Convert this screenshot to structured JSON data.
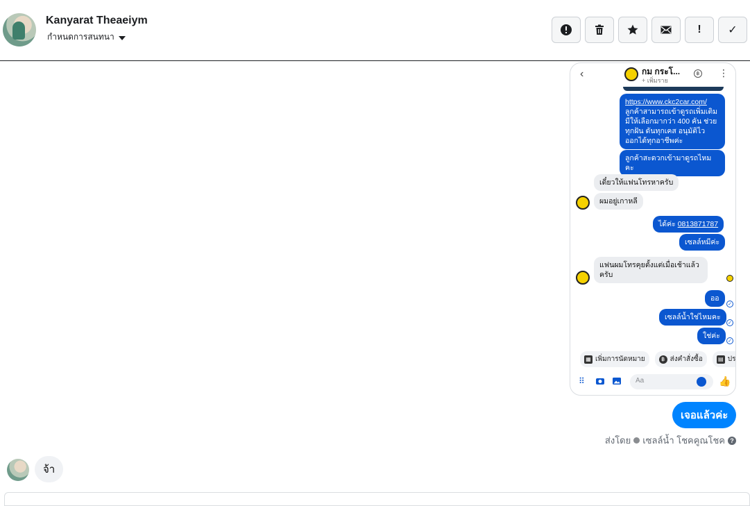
{
  "header": {
    "contact_name": "Kanyarat Theaeiym",
    "assign_label": "กำหนดการสนทนา",
    "actions": [
      {
        "icon": "alert-circle-icon"
      },
      {
        "icon": "trash-icon"
      },
      {
        "icon": "star-icon"
      },
      {
        "icon": "mail-icon"
      },
      {
        "icon": "exclamation-icon",
        "glyph": "!"
      },
      {
        "icon": "check-icon",
        "glyph": "✓"
      }
    ]
  },
  "screenshot": {
    "title": "กม กระโ...",
    "subtitle": "+ เพิ่มราย",
    "messages": {
      "link": "https://www.ckc2car.com/",
      "out1": "ลูกค้าสามารถเข้าดูรถเพิ่มเติม มีให้เลือกมากว่า 400 คัน ช่วยทุกฝัน ดันทุกเคส อนุมัติไว ออกได้ทุกอาชีพค่ะ",
      "out2": "ลูกค้าสะดวกเข้ามาดูรถไหมคะ",
      "in1": "เดี๋ยวให้แฟนโทรหาครับ",
      "in2": "ผมอยู่เกาหลี",
      "out3_prefix": "ได้ค่ะ ",
      "out3_phone": "0813871787",
      "out4": "เซลล์หมีค่ะ",
      "in3": "แฟนผมโทรคุยตั้งแต่เมื่อเช้าแล้วครับ",
      "out5": "ออ",
      "out6": "เซลล์น้ำใช่ไหมคะ",
      "out7": "ใช่ค่ะ"
    },
    "chips": [
      "เพิ่มการนัดหมาย",
      "ส่งคำสั่งซื้อ",
      "ประ"
    ],
    "composer_placeholder": "Aa"
  },
  "thread": {
    "sent_message": "เจอแล้วค่ะ",
    "sent_by_prefix": "ส่งโดย",
    "sent_by_name": "เซลล์น้ำ โชคคูณโชค",
    "received_message": "จ้า"
  }
}
